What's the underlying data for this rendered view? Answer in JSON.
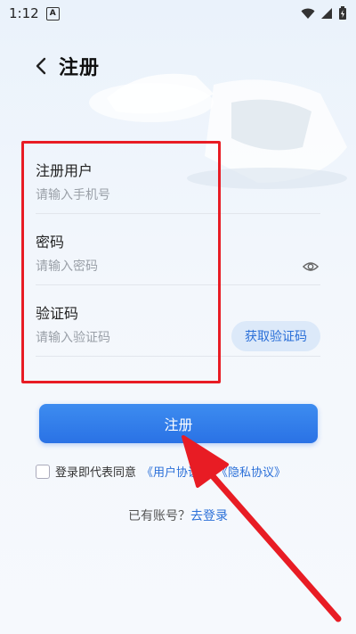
{
  "status_bar": {
    "time": "1:12",
    "notif_letter": "A"
  },
  "header": {
    "title": "注册"
  },
  "form": {
    "username": {
      "label": "注册用户",
      "placeholder": "请输入手机号"
    },
    "password": {
      "label": "密码",
      "placeholder": "请输入密码"
    },
    "code": {
      "label": "验证码",
      "placeholder": "请输入验证码",
      "button": "获取验证码"
    }
  },
  "register_button": "注册",
  "agreement": {
    "prefix": "登录即代表同意",
    "user_agreement": "《用户协议》",
    "privacy_agreement": "《隐私协议》"
  },
  "login_prompt": {
    "text": "已有账号？",
    "link": "去登录"
  },
  "colors": {
    "accent": "#2a72e5",
    "annotation": "#e81c24"
  }
}
